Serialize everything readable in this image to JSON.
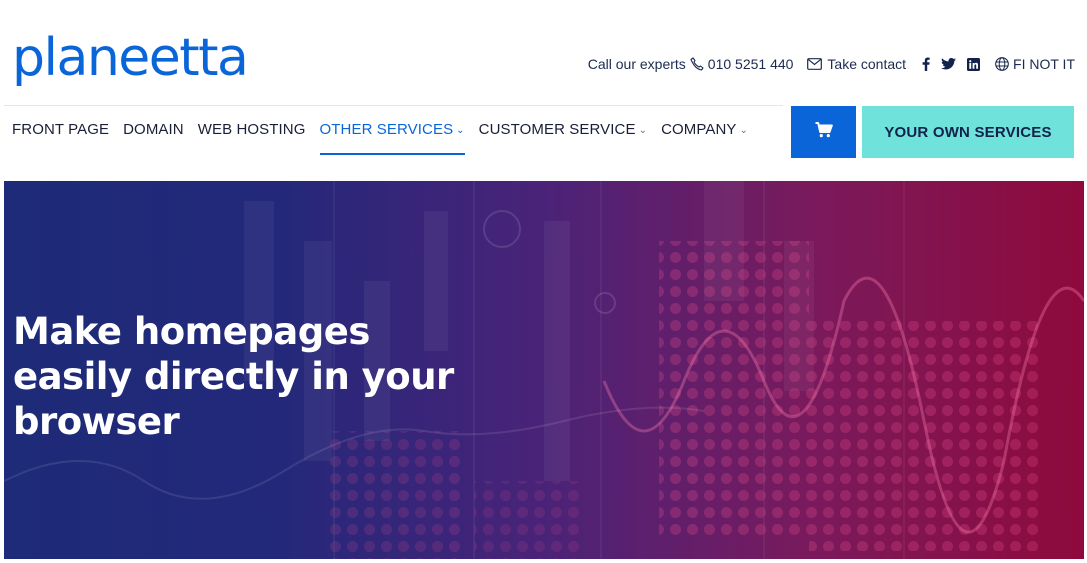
{
  "brand": {
    "logo_text": "planeetta",
    "color": "#0a66d8"
  },
  "topbar": {
    "call_label": "Call our experts",
    "phone_number": "010 5251 440",
    "contact_label": "Take contact",
    "language": "FI NOT IT",
    "icons": [
      "phone-icon",
      "mail-icon",
      "facebook-icon",
      "twitter-icon",
      "linkedin-icon",
      "globe-icon"
    ]
  },
  "nav": {
    "items": [
      {
        "label": "FRONT PAGE",
        "dropdown": false,
        "active": false
      },
      {
        "label": "DOMAIN",
        "dropdown": false,
        "active": false
      },
      {
        "label": "WEB HOSTING",
        "dropdown": false,
        "active": false
      },
      {
        "label": "OTHER SERVICES",
        "dropdown": true,
        "active": true
      },
      {
        "label": "CUSTOMER SERVICE",
        "dropdown": true,
        "active": false
      },
      {
        "label": "COMPANY",
        "dropdown": true,
        "active": false
      }
    ],
    "chevron": "⌄"
  },
  "actions": {
    "cart_icon": "cart-icon",
    "own_services_label": "YOUR OWN SERVICES",
    "cart_color": "#0a66d8",
    "own_services_color": "#6fe3db"
  },
  "hero": {
    "title_lines": [
      "Make homepages",
      "easily directly in your",
      "browser"
    ],
    "gradient_start": "#1d2b78",
    "gradient_end": "#8f0a3c"
  }
}
